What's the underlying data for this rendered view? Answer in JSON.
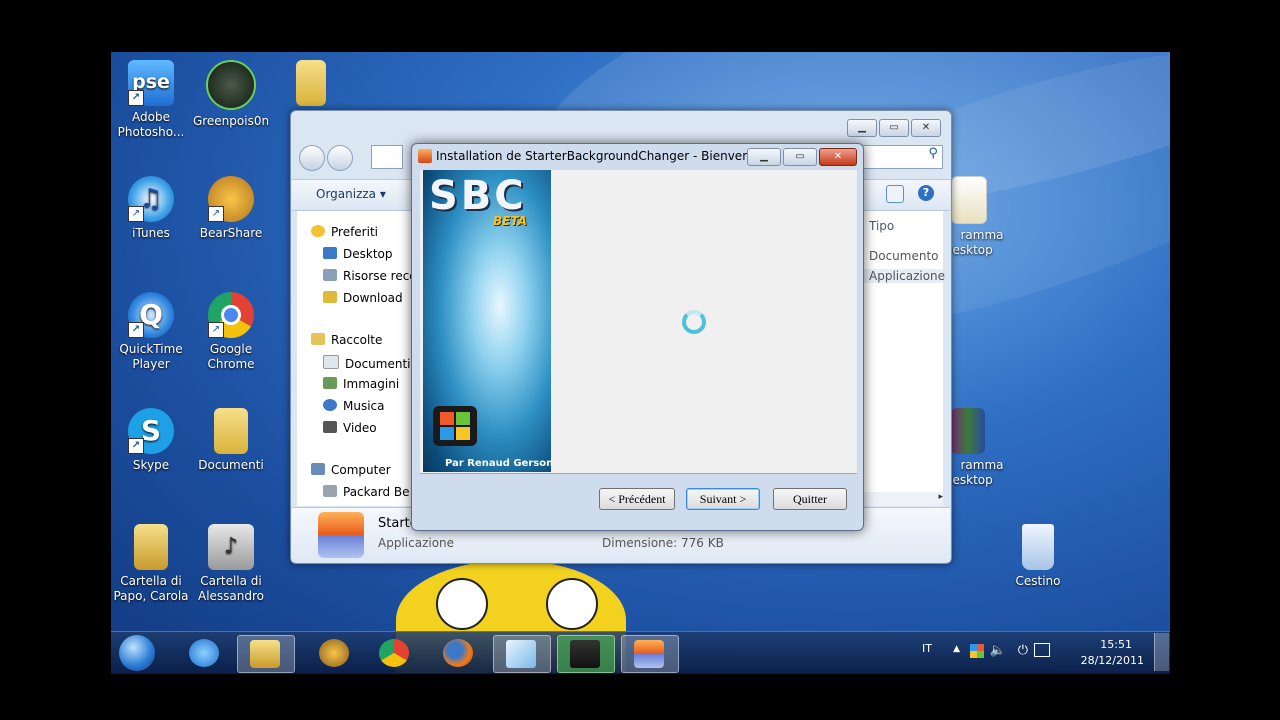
{
  "desktop_icons": [
    {
      "label": "Adobe Photosho...",
      "icon": "photoshop-elements-icon",
      "glyph": "pse"
    },
    {
      "label": "Greenpois0n",
      "icon": "greenpoison-icon",
      "glyph": ""
    },
    {
      "label": "iTunes",
      "icon": "itunes-icon",
      "glyph": "♫"
    },
    {
      "label": "BearShare",
      "icon": "bearshare-icon",
      "glyph": ""
    },
    {
      "label": "QuickTime Player",
      "icon": "quicktime-icon",
      "glyph": "Q"
    },
    {
      "label": "Google Chrome",
      "icon": "chrome-icon",
      "glyph": ""
    },
    {
      "label": "Skype",
      "icon": "skype-icon",
      "glyph": "S"
    },
    {
      "label": "Documenti",
      "icon": "folder-icon",
      "glyph": ""
    },
    {
      "label": "Cartella di Papo, Carola",
      "icon": "folder-icon",
      "glyph": ""
    },
    {
      "label": "Cartella di Alessandro",
      "icon": "music-folder-icon",
      "glyph": "♪"
    },
    {
      "label": "Cestino",
      "icon": "recycle-bin-icon",
      "glyph": ""
    },
    {
      "label": "ramma Desktop",
      "icon": "program-icon",
      "glyph": ""
    },
    {
      "label": "ramma Desktop",
      "icon": "winrar-icon",
      "glyph": ""
    }
  ],
  "explorer": {
    "toolbar_organize": "Organizza ▾",
    "nav": {
      "favorites": "Preferiti",
      "desktop": "Desktop",
      "recent": "Risorse rece",
      "download": "Download",
      "libraries": "Raccolte",
      "documents": "Documenti",
      "images": "Immagini",
      "music": "Musica",
      "video": "Video",
      "computer": "Computer",
      "drive": "Packard Be"
    },
    "columns": {
      "type_header": "Tipo",
      "row1": "Documento",
      "row2": "Applicazione"
    },
    "details": {
      "name": "Starte",
      "type": "Applicazione",
      "size": "Dimensione: 776 KB"
    }
  },
  "installer": {
    "title": "Installation de StarterBackgroundChanger - Bienvenue",
    "logo": "SBC",
    "beta": "BETA",
    "author": "Par Renaud Gerson",
    "buttons": {
      "back": "< Précédent",
      "next": "Suivant >",
      "quit": "Quitter"
    }
  },
  "taskbar": {
    "language": "IT",
    "time": "15:51",
    "date": "28/12/2011"
  },
  "colors": {
    "desktop_blue": "#1c4fa0",
    "installer_accent": "#2d8fc3",
    "beta_yellow": "#f5c52a"
  }
}
